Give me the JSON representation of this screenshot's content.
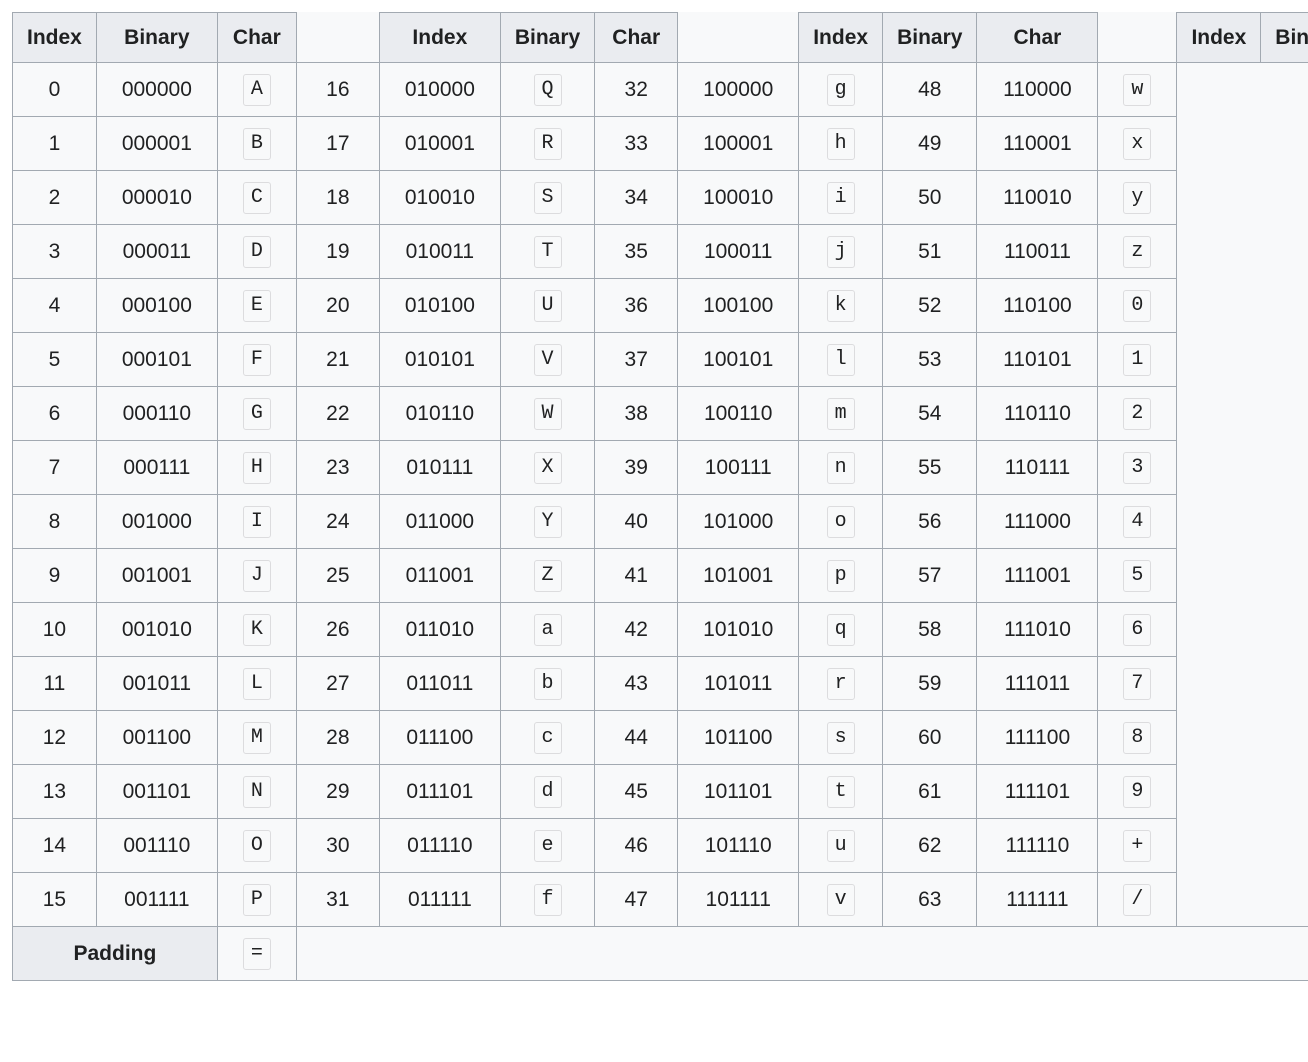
{
  "headers": {
    "index": "Index",
    "binary": "Binary",
    "char": "Char"
  },
  "padding": {
    "label": "Padding",
    "char": "="
  },
  "groups": [
    {
      "rows": [
        {
          "index": "0",
          "binary": "000000",
          "char": "A"
        },
        {
          "index": "1",
          "binary": "000001",
          "char": "B"
        },
        {
          "index": "2",
          "binary": "000010",
          "char": "C"
        },
        {
          "index": "3",
          "binary": "000011",
          "char": "D"
        },
        {
          "index": "4",
          "binary": "000100",
          "char": "E"
        },
        {
          "index": "5",
          "binary": "000101",
          "char": "F"
        },
        {
          "index": "6",
          "binary": "000110",
          "char": "G"
        },
        {
          "index": "7",
          "binary": "000111",
          "char": "H"
        },
        {
          "index": "8",
          "binary": "001000",
          "char": "I"
        },
        {
          "index": "9",
          "binary": "001001",
          "char": "J"
        },
        {
          "index": "10",
          "binary": "001010",
          "char": "K"
        },
        {
          "index": "11",
          "binary": "001011",
          "char": "L"
        },
        {
          "index": "12",
          "binary": "001100",
          "char": "M"
        },
        {
          "index": "13",
          "binary": "001101",
          "char": "N"
        },
        {
          "index": "14",
          "binary": "001110",
          "char": "O"
        },
        {
          "index": "15",
          "binary": "001111",
          "char": "P"
        }
      ]
    },
    {
      "rows": [
        {
          "index": "16",
          "binary": "010000",
          "char": "Q"
        },
        {
          "index": "17",
          "binary": "010001",
          "char": "R"
        },
        {
          "index": "18",
          "binary": "010010",
          "char": "S"
        },
        {
          "index": "19",
          "binary": "010011",
          "char": "T"
        },
        {
          "index": "20",
          "binary": "010100",
          "char": "U"
        },
        {
          "index": "21",
          "binary": "010101",
          "char": "V"
        },
        {
          "index": "22",
          "binary": "010110",
          "char": "W"
        },
        {
          "index": "23",
          "binary": "010111",
          "char": "X"
        },
        {
          "index": "24",
          "binary": "011000",
          "char": "Y"
        },
        {
          "index": "25",
          "binary": "011001",
          "char": "Z"
        },
        {
          "index": "26",
          "binary": "011010",
          "char": "a"
        },
        {
          "index": "27",
          "binary": "011011",
          "char": "b"
        },
        {
          "index": "28",
          "binary": "011100",
          "char": "c"
        },
        {
          "index": "29",
          "binary": "011101",
          "char": "d"
        },
        {
          "index": "30",
          "binary": "011110",
          "char": "e"
        },
        {
          "index": "31",
          "binary": "011111",
          "char": "f"
        }
      ]
    },
    {
      "rows": [
        {
          "index": "32",
          "binary": "100000",
          "char": "g"
        },
        {
          "index": "33",
          "binary": "100001",
          "char": "h"
        },
        {
          "index": "34",
          "binary": "100010",
          "char": "i"
        },
        {
          "index": "35",
          "binary": "100011",
          "char": "j"
        },
        {
          "index": "36",
          "binary": "100100",
          "char": "k"
        },
        {
          "index": "37",
          "binary": "100101",
          "char": "l"
        },
        {
          "index": "38",
          "binary": "100110",
          "char": "m"
        },
        {
          "index": "39",
          "binary": "100111",
          "char": "n"
        },
        {
          "index": "40",
          "binary": "101000",
          "char": "o"
        },
        {
          "index": "41",
          "binary": "101001",
          "char": "p"
        },
        {
          "index": "42",
          "binary": "101010",
          "char": "q"
        },
        {
          "index": "43",
          "binary": "101011",
          "char": "r"
        },
        {
          "index": "44",
          "binary": "101100",
          "char": "s"
        },
        {
          "index": "45",
          "binary": "101101",
          "char": "t"
        },
        {
          "index": "46",
          "binary": "101110",
          "char": "u"
        },
        {
          "index": "47",
          "binary": "101111",
          "char": "v"
        }
      ]
    },
    {
      "rows": [
        {
          "index": "48",
          "binary": "110000",
          "char": "w"
        },
        {
          "index": "49",
          "binary": "110001",
          "char": "x"
        },
        {
          "index": "50",
          "binary": "110010",
          "char": "y"
        },
        {
          "index": "51",
          "binary": "110011",
          "char": "z"
        },
        {
          "index": "52",
          "binary": "110100",
          "char": "0"
        },
        {
          "index": "53",
          "binary": "110101",
          "char": "1"
        },
        {
          "index": "54",
          "binary": "110110",
          "char": "2"
        },
        {
          "index": "55",
          "binary": "110111",
          "char": "3"
        },
        {
          "index": "56",
          "binary": "111000",
          "char": "4"
        },
        {
          "index": "57",
          "binary": "111001",
          "char": "5"
        },
        {
          "index": "58",
          "binary": "111010",
          "char": "6"
        },
        {
          "index": "59",
          "binary": "111011",
          "char": "7"
        },
        {
          "index": "60",
          "binary": "111100",
          "char": "8"
        },
        {
          "index": "61",
          "binary": "111101",
          "char": "9"
        },
        {
          "index": "62",
          "binary": "111110",
          "char": "+"
        },
        {
          "index": "63",
          "binary": "111111",
          "char": "/"
        }
      ]
    }
  ]
}
